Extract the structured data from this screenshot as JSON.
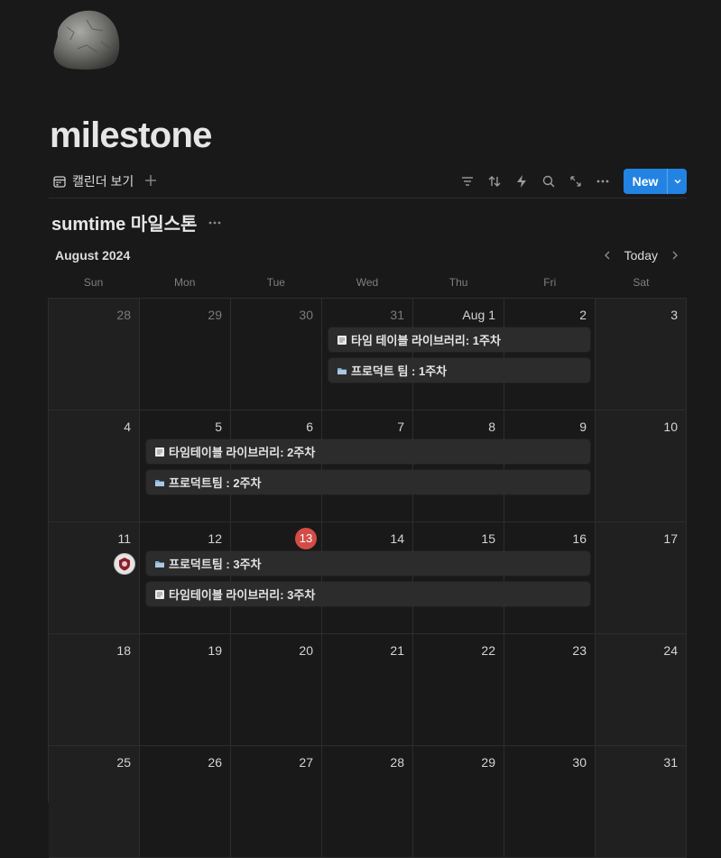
{
  "page": {
    "title": "milestone",
    "icon": "rock-icon"
  },
  "view_tab": {
    "label": "캘린더 보기"
  },
  "toolbar": {
    "new_label": "New"
  },
  "database": {
    "title": "sumtime 마일스톤"
  },
  "calendar": {
    "month_label": "August 2024",
    "today_label": "Today",
    "weekdays": [
      "Sun",
      "Mon",
      "Tue",
      "Wed",
      "Thu",
      "Fri",
      "Sat"
    ],
    "weeks": [
      [
        "28",
        "29",
        "30",
        "31",
        "Aug 1",
        "2",
        "3"
      ],
      [
        "4",
        "5",
        "6",
        "7",
        "8",
        "9",
        "10"
      ],
      [
        "11",
        "12",
        "13",
        "14",
        "15",
        "16",
        "17"
      ],
      [
        "18",
        "19",
        "20",
        "21",
        "22",
        "23",
        "24"
      ],
      [
        "25",
        "26",
        "27",
        "28",
        "29",
        "30",
        "31"
      ]
    ],
    "today": "13",
    "events": [
      {
        "title": "타임 테이블 라이브러리: 1주차",
        "icon": "note-icon"
      },
      {
        "title": "프로덕트 팀 : 1주차",
        "icon": "folder-icon"
      },
      {
        "title": "타임테이블 라이브러리: 2주차",
        "icon": "note-icon"
      },
      {
        "title": "프로덕트팀 : 2주차",
        "icon": "folder-icon"
      },
      {
        "title": "프로덕트팀 : 3주차",
        "icon": "folder-icon"
      },
      {
        "title": "타임테이블 라이브러리: 3주차",
        "icon": "note-icon"
      }
    ]
  }
}
